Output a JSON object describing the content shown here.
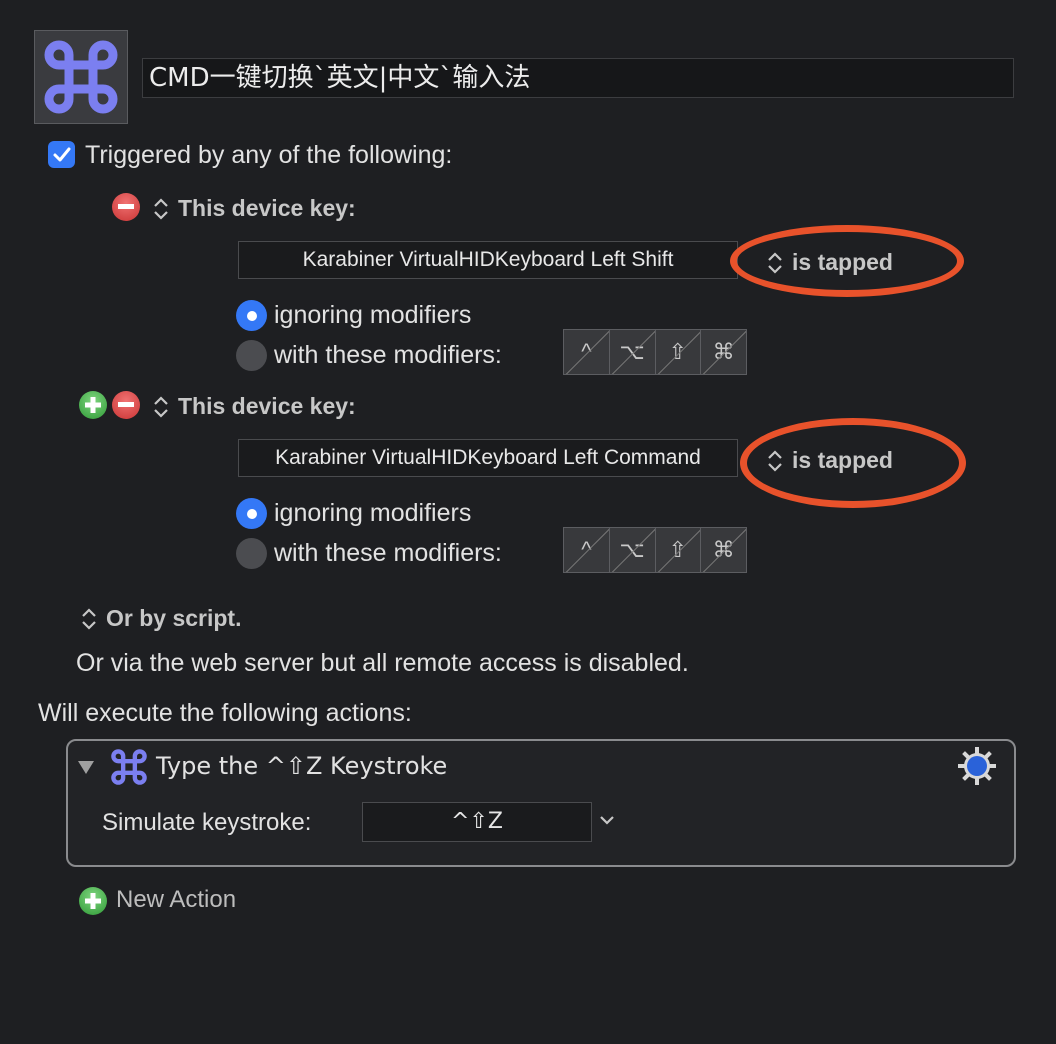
{
  "macro": {
    "icon": "command-icon",
    "name": "CMD一键切换`英文|中文`输入法"
  },
  "trigger": {
    "checkbox_checked": true,
    "label": "Triggered by any of the following:",
    "device_keys": [
      {
        "heading": "This device key:",
        "device": "Karabiner VirtualHIDKeyboard Left Shift",
        "condition": "is tapped",
        "ignoring_label": "ignoring modifiers",
        "with_label": "with these modifiers:",
        "selected": "ignoring",
        "modifiers": [
          "^",
          "⌥",
          "⇧",
          "⌘"
        ]
      },
      {
        "heading": "This device key:",
        "device": "Karabiner VirtualHIDKeyboard Left Command",
        "condition": "is tapped",
        "ignoring_label": "ignoring modifiers",
        "with_label": "with these modifiers:",
        "selected": "ignoring",
        "modifiers": [
          "^",
          "⌥",
          "⇧",
          "⌘"
        ]
      }
    ],
    "script_label": "Or by script.",
    "web_server_text": "Or via the web server but all remote access is disabled."
  },
  "actions": {
    "header": "Will execute the following actions:",
    "items": [
      {
        "title": "Type the ^⇧Z Keystroke",
        "field_label": "Simulate keystroke:",
        "keystroke": "^⇧Z"
      }
    ],
    "new_action_label": "New Action"
  },
  "colors": {
    "background": "#1e1f22",
    "accent": "#3478f6",
    "highlight_ellipse": "#e8522b",
    "icon_purple": "#7b7ff0"
  }
}
